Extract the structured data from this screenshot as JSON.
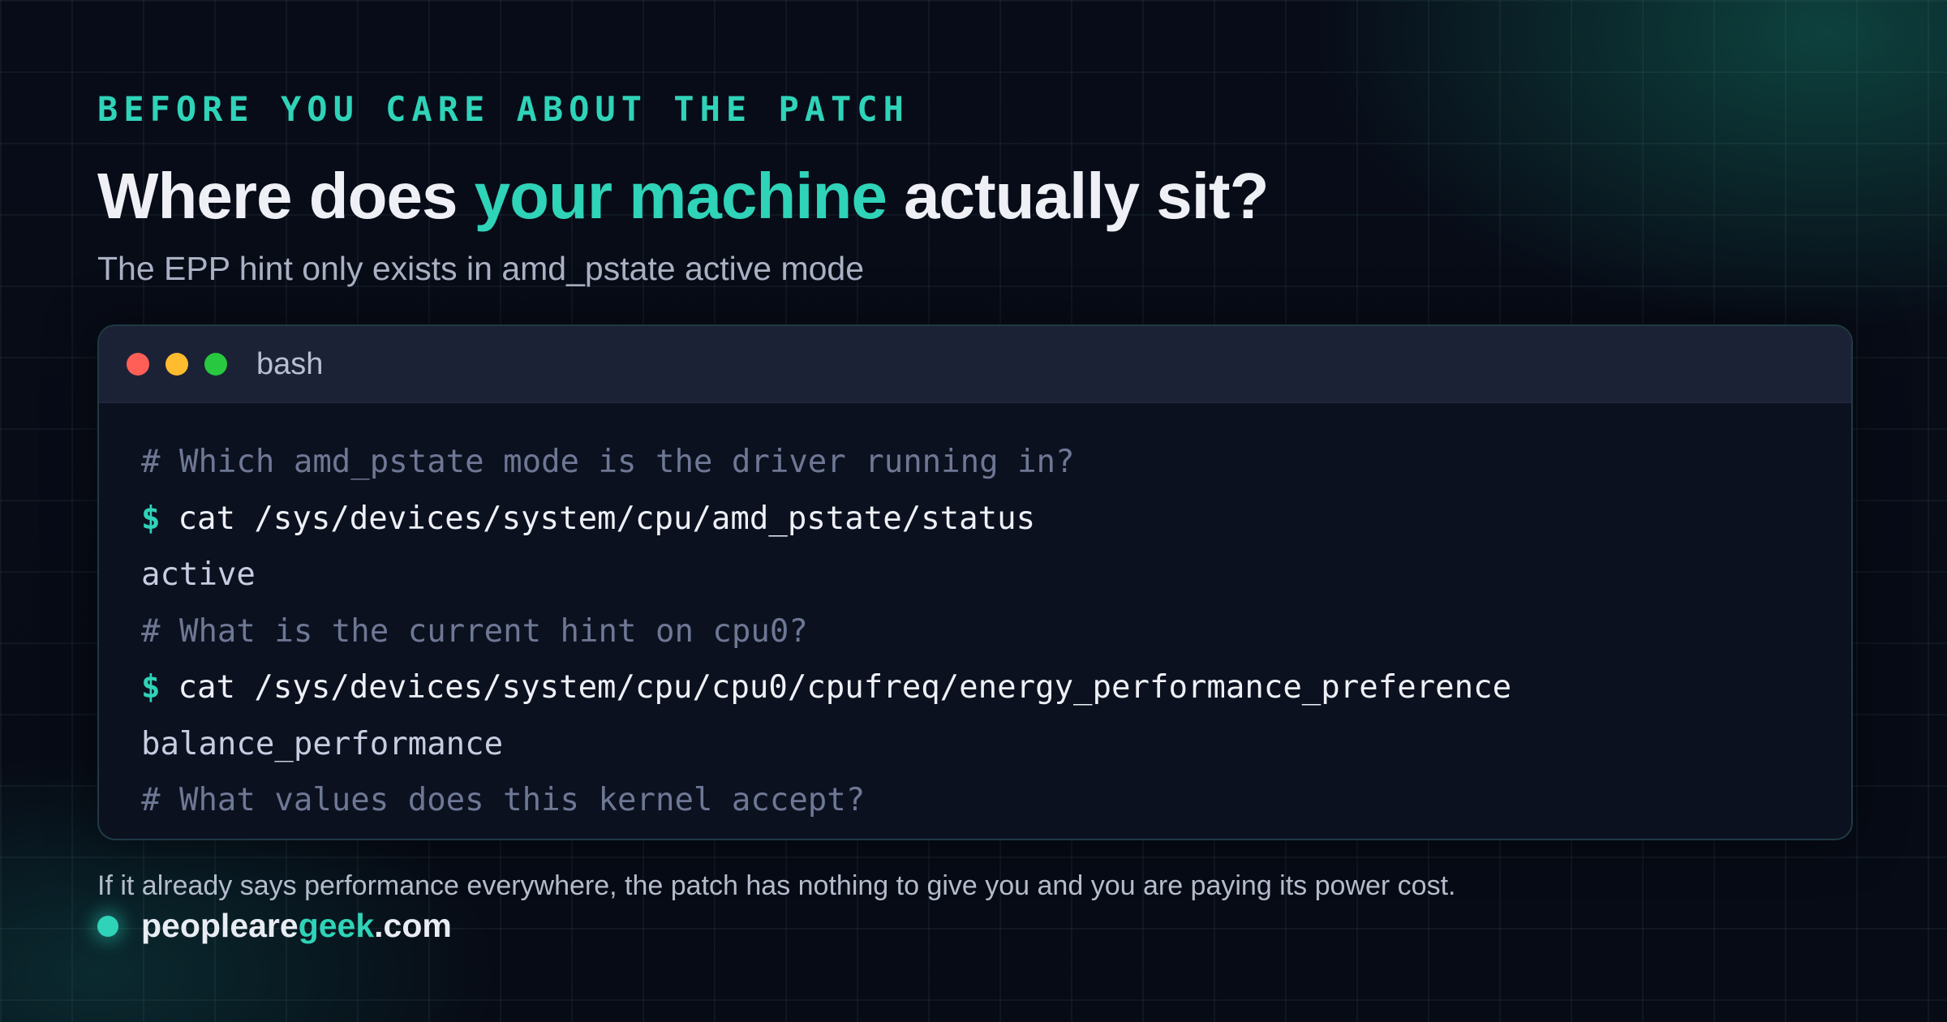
{
  "eyebrow": "BEFORE YOU CARE ABOUT THE PATCH",
  "headline": {
    "before": "Where does ",
    "accent": "your machine",
    "after": " actually sit?"
  },
  "subtitle": "The EPP hint only exists in amd_pstate active mode",
  "terminal": {
    "title": "bash",
    "prompt_symbol": "$",
    "lines": [
      {
        "type": "comment",
        "text": "# Which amd_pstate mode is the driver running in?"
      },
      {
        "type": "command",
        "text": "cat /sys/devices/system/cpu/amd_pstate/status"
      },
      {
        "type": "output",
        "text": "active"
      },
      {
        "type": "comment",
        "text": "# What is the current hint on cpu0?"
      },
      {
        "type": "command",
        "text": "cat /sys/devices/system/cpu/cpu0/cpufreq/energy_performance_preference"
      },
      {
        "type": "output",
        "text": "balance_performance"
      },
      {
        "type": "comment",
        "text": "# What values does this kernel accept?"
      }
    ]
  },
  "footer_note": "If it already says performance everywhere, the patch has nothing to give you and you are paying its power cost.",
  "brand": {
    "part1": "peopleare",
    "accent": "geek",
    "part2": ".com"
  },
  "colors": {
    "accent": "#2fd3b8",
    "background": "#070b16",
    "terminal_bg": "#0c1120",
    "dot_red": "#ff5f57",
    "dot_yellow": "#febc2e",
    "dot_green": "#28c840"
  },
  "icons": [
    "window-close-dot-icon",
    "window-minimize-dot-icon",
    "window-maximize-dot-icon",
    "brand-dot-icon"
  ]
}
